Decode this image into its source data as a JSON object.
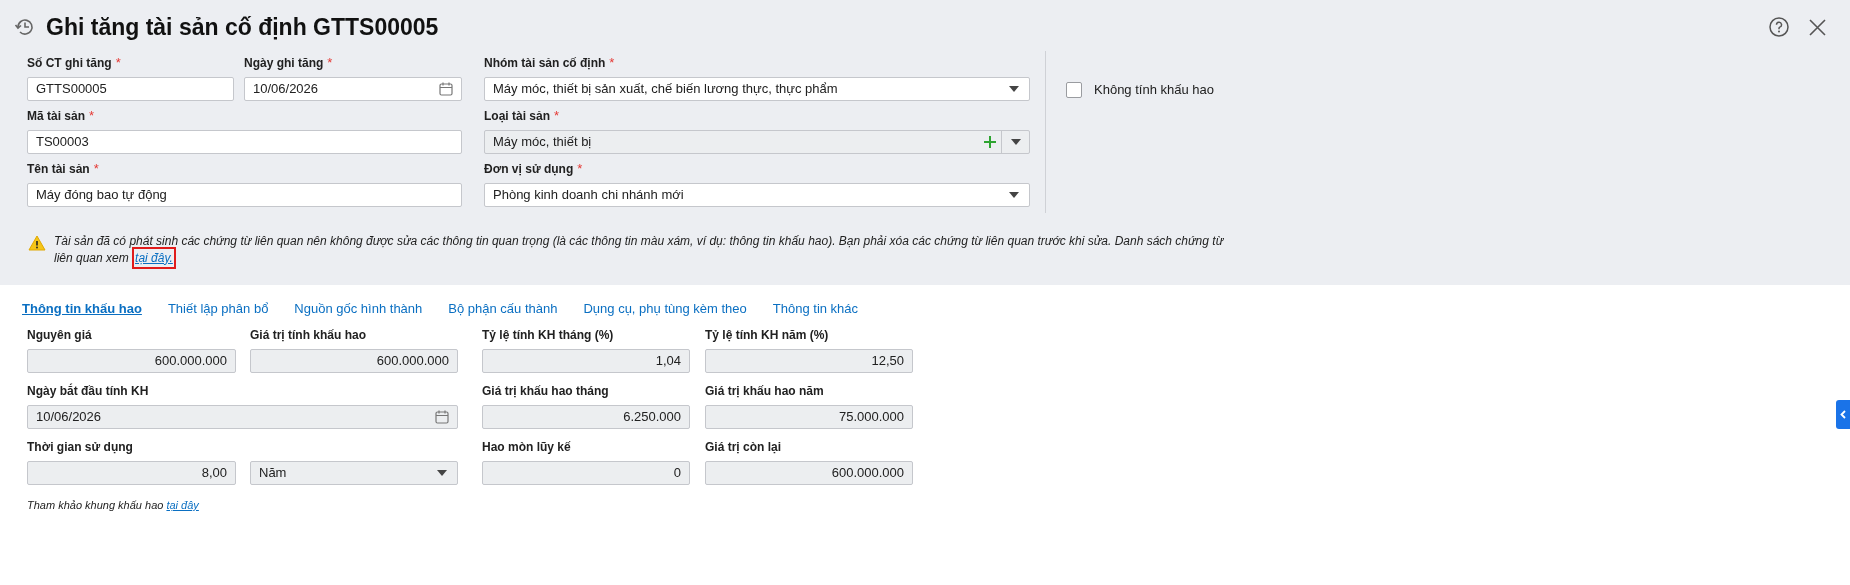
{
  "title": "Ghi tăng tài sản cố định GTTS00005",
  "top_rows": [
    {
      "fields": [
        {
          "label": "Số CT ghi tăng",
          "required_mark": "*",
          "kind": "text",
          "value": "GTTS00005",
          "disabled": false
        },
        {
          "label": "Ngày ghi tăng",
          "required_mark": "*",
          "kind": "date",
          "value": "10/06/2026",
          "disabled": false
        },
        {
          "label": "Nhóm tài sản cố định",
          "required_mark": "*",
          "kind": "select",
          "value": "Máy móc, thiết bị sản xuất, chế biến lương thực, thực phẩm",
          "disabled": false
        }
      ]
    },
    {
      "fields": [
        {
          "label": "Mã tài sản",
          "required_mark": "*",
          "kind": "text",
          "value": "TS00003",
          "disabled": false
        },
        {
          "label": "Loại tài sản",
          "required_mark": "*",
          "kind": "combo",
          "value": "Máy móc, thiết bị",
          "disabled": true
        }
      ]
    },
    {
      "fields": [
        {
          "label": "Tên tài sản",
          "required_mark": "*",
          "kind": "text",
          "value": "Máy đóng bao tự động",
          "disabled": false
        },
        {
          "label": "Đơn vị sử dụng",
          "required_mark": "*",
          "kind": "select",
          "value": "Phòng kinh doanh chi nhánh mới",
          "disabled": false
        }
      ]
    }
  ],
  "checkbox": {
    "label": "Không tính khấu hao",
    "checked": false
  },
  "warning": {
    "text": "Tài sản đã có phát sinh các chứng từ liên quan nên không được sửa các thông tin quan trọng (là các thông tin màu xám, ví dụ: thông tin khấu hao). Bạn phải xóa các chứng từ liên quan trước khi sửa. Danh sách chứng từ liên quan xem",
    "link": "tại đây.",
    "highlighted": true
  },
  "tabs": [
    {
      "label": "Thông tin khấu hao",
      "selected": true
    },
    {
      "label": "Thiết lập phân bổ",
      "selected": false
    },
    {
      "label": "Nguồn gốc hình thành",
      "selected": false
    },
    {
      "label": "Bộ phận cấu thành",
      "selected": false
    },
    {
      "label": "Dụng cụ, phụ tùng kèm theo",
      "selected": false
    },
    {
      "label": "Thông tin khác",
      "selected": false
    }
  ],
  "detail_rows": [
    {
      "fields": [
        {
          "label": "Nguyên giá",
          "kind": "number",
          "value": "600.000.000",
          "disabled": true
        },
        {
          "label": "Giá trị tính khấu hao",
          "kind": "number",
          "value": "600.000.000",
          "disabled": true
        },
        {
          "label": "Tỷ lệ tính KH tháng (%)",
          "kind": "number",
          "value": "1,04",
          "disabled": true
        },
        {
          "label": "Tỷ lệ tính KH năm (%)",
          "kind": "number",
          "value": "12,50",
          "disabled": true
        }
      ]
    },
    {
      "fields": [
        {
          "label": "Ngày bắt đầu tính KH",
          "kind": "date",
          "value": "10/06/2026",
          "disabled": true
        },
        {
          "label": "Giá trị khấu hao tháng",
          "kind": "number",
          "value": "6.250.000",
          "disabled": true
        },
        {
          "label": "Giá trị khấu hao năm",
          "kind": "number",
          "value": "75.000.000",
          "disabled": true
        }
      ]
    },
    {
      "fields": [
        {
          "label": "Thời gian sử dụng",
          "kind": "number",
          "value": "8,00",
          "disabled": true
        },
        {
          "kind": "select",
          "value": "Năm",
          "disabled": true
        },
        {
          "label": "Hao mòn lũy kế",
          "kind": "number",
          "value": "0",
          "disabled": true
        },
        {
          "label": "Giá trị còn lại",
          "kind": "number",
          "value": "600.000.000",
          "disabled": true
        }
      ]
    }
  ],
  "footnote": {
    "text": "Tham khảo khung khấu hao",
    "link": "tại đây"
  }
}
